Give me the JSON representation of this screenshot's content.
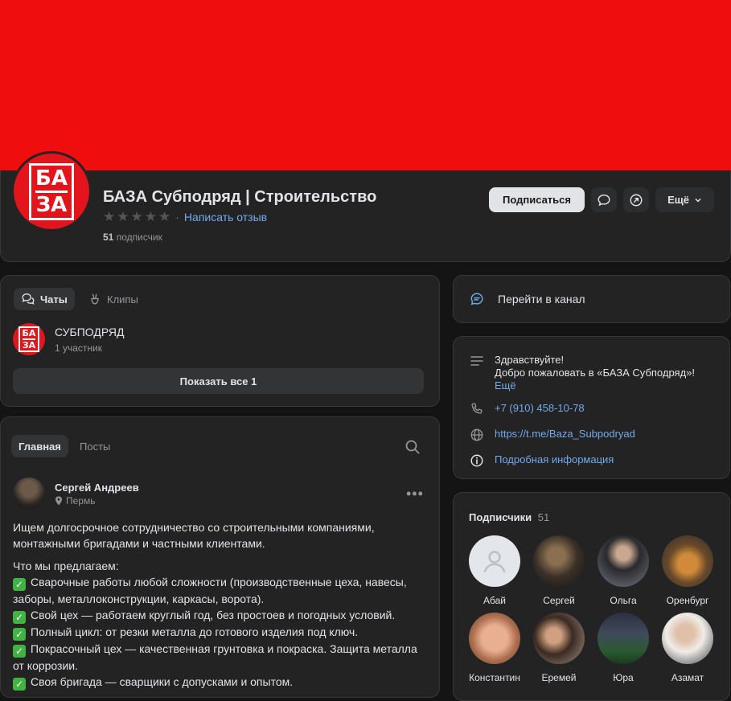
{
  "group": {
    "title": "БАЗА Субподряд | Строительство",
    "review_link": "Написать отзыв",
    "subscribers_num": "51",
    "subscribers_label": "подписчик",
    "logo_top": "БА",
    "logo_bottom": "ЗА"
  },
  "actions": {
    "subscribe": "Подписаться",
    "more": "Ещё"
  },
  "chats": {
    "tab_chats": "Чаты",
    "tab_clips": "Клипы",
    "item_name": "СУБПОДРЯД",
    "item_members": "1 участник",
    "show_all": "Показать все 1"
  },
  "wall": {
    "tab_main": "Главная",
    "tab_posts": "Посты"
  },
  "post": {
    "author": "Сергей Андреев",
    "location": "Пермь",
    "intro": "Ищем долгосрочное сотрудничество со строительными компаниями, монтажными бригадами и частными клиентами.",
    "offer_heading": "Что мы предлагаем:",
    "bullets": [
      "Сварочные работы любой сложности (производственные цеха, навесы, заборы, металлоконструкции, каркасы, ворота).",
      "Свой цех — работаем круглый год, без простоев и погодных условий.",
      "Полный цикл: от резки металла до готового изделия под ключ.",
      "Покрасочный цех — качественная грунтовка и покраска. Защита металла от коррозии.",
      "Своя бригада — сварщики с допусками и опытом."
    ]
  },
  "channel": {
    "label": "Перейти в канал"
  },
  "info": {
    "greeting_line1": "Здравствуйте!",
    "greeting_line2": "Добро пожаловать в «БАЗА Субподряд»!",
    "more_link": "Ещё",
    "phone": "+7 (910) 458-10-78",
    "website": "https://t.me/Baza_Subpodryad",
    "details": "Подробная информация"
  },
  "subscribers": {
    "title": "Подписчики",
    "count": "51",
    "members": [
      "Абай",
      "Сергей",
      "Ольга",
      "Оренбург",
      "Константин",
      "Еремей",
      "Юра",
      "Азамат"
    ]
  },
  "colors": {
    "cover": "#f00d0d",
    "card": "#232324",
    "accent_link": "#71aaeb",
    "check": "#40b343"
  }
}
